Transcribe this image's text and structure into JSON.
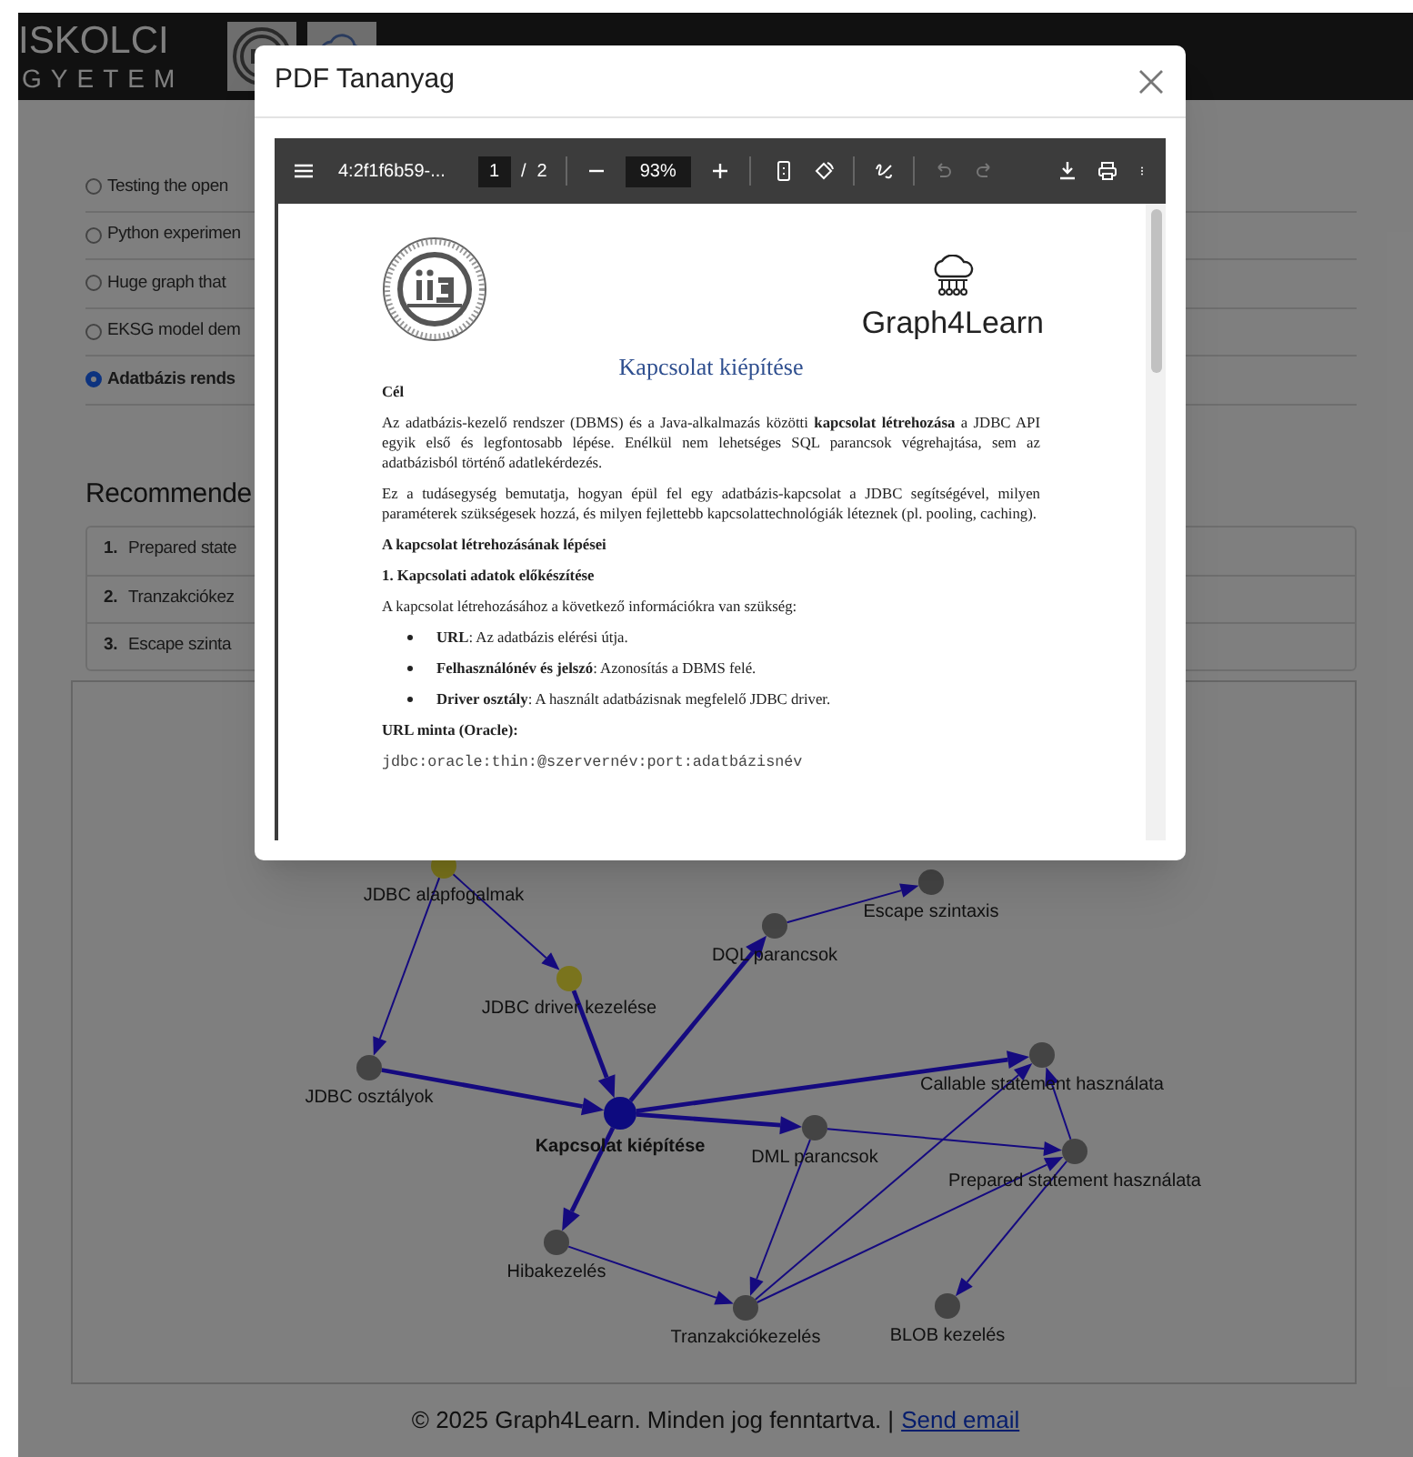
{
  "header": {
    "logo_lines": [
      "ISKOLCI",
      "GYETEM"
    ]
  },
  "projects": [
    {
      "label": "Testing the open",
      "selected": false
    },
    {
      "label": "Python experimen",
      "selected": false
    },
    {
      "label": "Huge graph that",
      "selected": false
    },
    {
      "label": "EKSG model dem",
      "selected": false
    },
    {
      "label": "Adatbázis rends",
      "selected": true
    }
  ],
  "recommended": {
    "title": "Recommende",
    "items": [
      {
        "number": "1.",
        "label": "Prepared state"
      },
      {
        "number": "2.",
        "label": "Tranzakciókez"
      },
      {
        "number": "3.",
        "label": "Escape szinta"
      }
    ]
  },
  "graph": {
    "nodes": [
      {
        "label": "JDBC alapfogalmak",
        "kind": "prerequisite"
      },
      {
        "label": "JDBC driver kezelése",
        "kind": "prerequisite"
      },
      {
        "label": "JDBC osztályok",
        "kind": "topic"
      },
      {
        "label": "Kapcsolat kiépítése",
        "kind": "current"
      },
      {
        "label": "DQL parancsok",
        "kind": "topic"
      },
      {
        "label": "Escape szintaxis",
        "kind": "topic"
      },
      {
        "label": "Callable statement használata",
        "kind": "topic"
      },
      {
        "label": "DML parancsok",
        "kind": "topic"
      },
      {
        "label": "Prepared statement használata",
        "kind": "topic"
      },
      {
        "label": "Hibakezelés",
        "kind": "topic"
      },
      {
        "label": "Tranzakciókezelés",
        "kind": "topic"
      },
      {
        "label": "BLOB kezelés",
        "kind": "topic"
      }
    ]
  },
  "footer": {
    "text": "© 2025 Graph4Learn. Minden jog fenntartva. |",
    "link": "Send email"
  },
  "modal": {
    "title": "PDF Tananyag",
    "toolbar": {
      "file_name": "4:2f1f6b59-...",
      "page": "1",
      "page_separator": "/",
      "page_count": "2",
      "zoom": "93%",
      "undo_disabled": true,
      "redo_disabled": true
    },
    "document": {
      "logo_text": "Graph4Learn",
      "title": "Kapcsolat kiépítése",
      "blocks": [
        {
          "kind": "heading",
          "text": "Cél"
        },
        {
          "kind": "paragraph",
          "text": "Az adatbázis-kezelő rendszer (DBMS) és a Java-alkalmazás közötti **kapcsolat létrehozása** a JDBC API egyik első és legfontosabb lépése. Enélkül nem lehetséges SQL parancsok végrehajtása, sem az adatbázisból történő adatlekérdezés."
        },
        {
          "kind": "paragraph",
          "text": "Ez a tudásegység bemutatja, hogyan épül fel egy adatbázis-kapcsolat a JDBC segítségével, milyen paraméterek szükségesek hozzá, és milyen fejlettebb kapcsolattechnológiák léteznek (pl. pooling, caching)."
        },
        {
          "kind": "heading",
          "text": "A kapcsolat létrehozásának lépései"
        },
        {
          "kind": "heading",
          "text": "1. Kapcsolati adatok előkészítése"
        },
        {
          "kind": "paragraph",
          "text": "A kapcsolat létrehozásához a következő információkra van szükség:"
        },
        {
          "kind": "bullet",
          "text": "**URL**: Az adatbázis elérési útja."
        },
        {
          "kind": "bullet",
          "text": "**Felhasználónév és jelszó**: Azonosítás a DBMS felé."
        },
        {
          "kind": "bullet",
          "text": "**Driver osztály**: A használt adatbázisnak megfelelő JDBC driver."
        },
        {
          "kind": "heading",
          "text": "URL minta (Oracle):"
        },
        {
          "kind": "code",
          "text": "jdbc:oracle:thin:@szervernév:port:adatbázisnév"
        }
      ]
    }
  }
}
